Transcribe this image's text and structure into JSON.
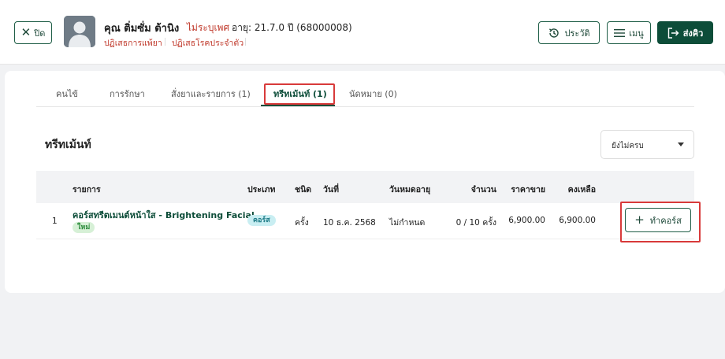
{
  "header": {
    "close_label": "ปิด",
    "patient_name": "คุณ ติ่มซั่ม ต้านิง",
    "gender": "ไม่ระบุเพศ",
    "age_text": "อายุ: 21.7.0 ปี  (68000008)",
    "allergy": "ปฏิเสธการแพ้ยา",
    "chronic": "ปฏิเสธโรคประจำตัว",
    "history_label": "ประวัติ",
    "menu_label": "เมนู",
    "send_label": "ส่งคิว"
  },
  "tabs": [
    {
      "label": "คนไข้"
    },
    {
      "label": "การรักษา"
    },
    {
      "label": "สั่งยาและรายการ (1)"
    },
    {
      "label": "ทรีทเม้นท์ (1)"
    },
    {
      "label": "นัดหมาย (0)"
    }
  ],
  "active_tab": "ทรีทเม้นท์ (1)",
  "section": {
    "title": "ทรีทเม้นท์",
    "filter_value": "ยังไม่ครบ"
  },
  "table": {
    "columns": [
      "รายการ",
      "ประเภท",
      "ชนิด",
      "วันที่",
      "วันหมดอายุ",
      "จำนวน",
      "ราคาขาย",
      "คงเหลือ"
    ],
    "rows": [
      {
        "no": "1",
        "name": "คอร์สทรีตเมนต์หน้าใส - Brightening Facial",
        "badge": "ใหม่",
        "type": "คอร์ส",
        "unit": "ครั้ง",
        "date": "10 ธ.ค. 2568",
        "expire": "ไม่กำหนด",
        "quantity": "0 / 10 ครั้ง",
        "price": "6,900.00",
        "remaining": "6,900.00",
        "action_label": "ทำคอร์ส"
      }
    ]
  },
  "colors": {
    "primary": "#0d4d39",
    "danger": "#c0392b",
    "highlight": "#d83a3a"
  }
}
